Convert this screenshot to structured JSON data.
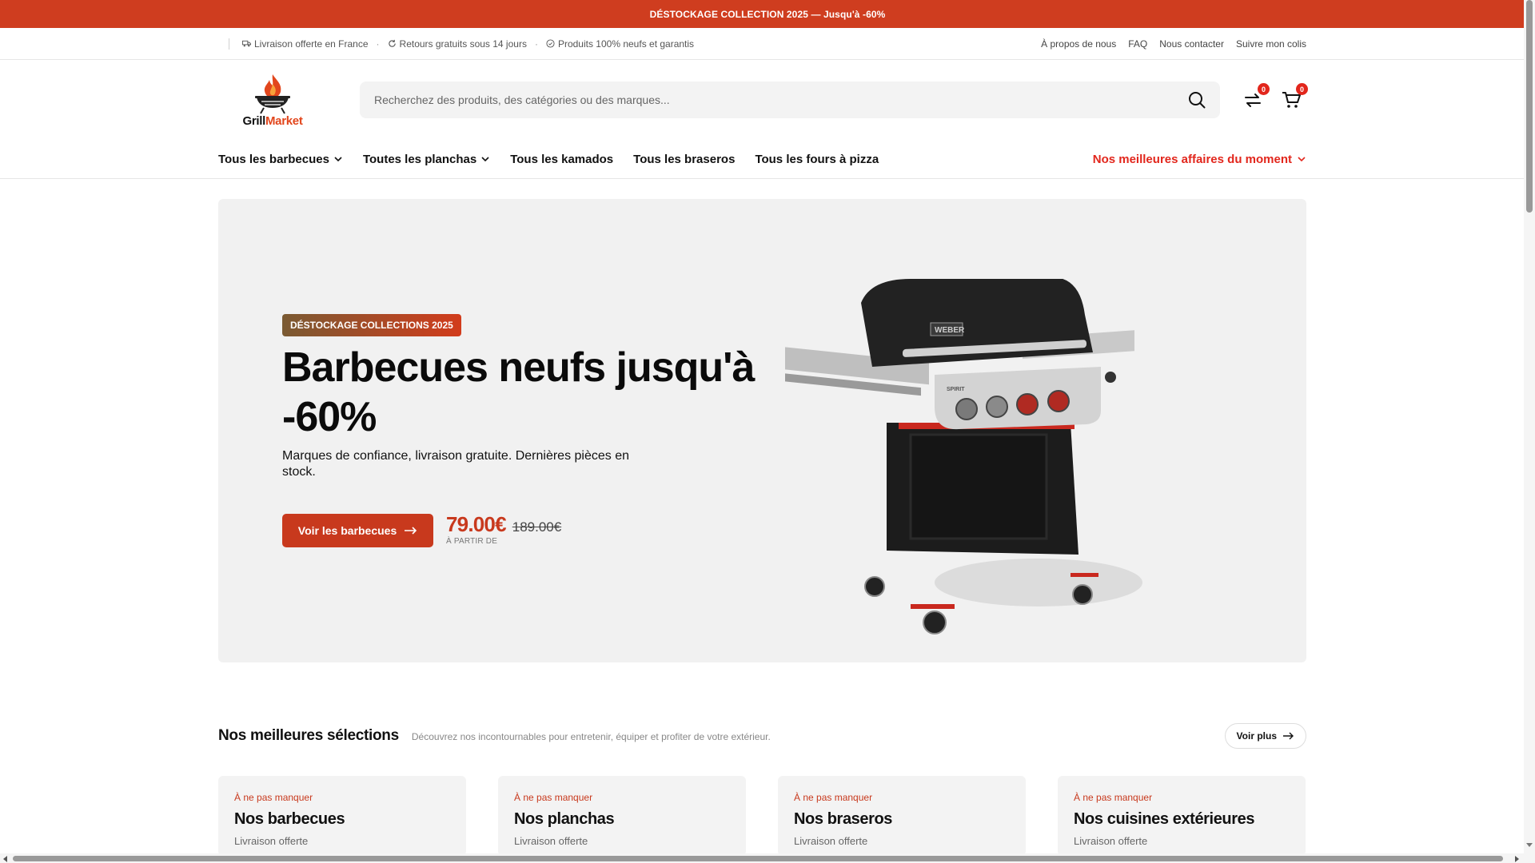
{
  "promo": {
    "text": "DÉSTOCKAGE COLLECTION 2025 — Jusqu'à -60%"
  },
  "utility": {
    "left": [
      {
        "icon": "truck-icon",
        "label": "Livraison offerte en France"
      },
      {
        "icon": "refresh-icon",
        "label": "Retours gratuits sous 14 jours"
      },
      {
        "icon": "check-circle-icon",
        "label": "Produits 100% neufs et garantis"
      }
    ],
    "right": [
      "À propos de nous",
      "FAQ",
      "Nous contacter",
      "Suivre mon colis"
    ]
  },
  "header": {
    "logo_grill": "Grill",
    "logo_market": "Market",
    "search_placeholder": "Recherchez des produits, des catégories ou des marques...",
    "compare_count": "0",
    "cart_count": "0"
  },
  "nav": {
    "items": [
      "Tous les barbecues",
      "Toutes les planchas",
      "Tous les kamados",
      "Tous les braseros",
      "Tous les fours à pizza"
    ],
    "deals": "Nos meilleures affaires du moment"
  },
  "hero": {
    "badge": "DÉSTOCKAGE COLLECTIONS 2025",
    "title": "Barbecues neufs jusqu'à -60%",
    "subtitle": "Marques de confiance, livraison gratuite. Dernières pièces en stock.",
    "cta": "Voir les barbecues",
    "price_new": "79.00€",
    "price_old": "189.00€",
    "price_label": "À PARTIR DE",
    "grill_brand": "WEBER",
    "grill_model": "SPIRIT"
  },
  "selections": {
    "title": "Nos meilleures sélections",
    "subtitle": "Découvrez nos incontournables pour entretenir, équiper et profiter de votre extérieur.",
    "more": "Voir plus",
    "cards": [
      {
        "eyebrow": "À ne pas manquer",
        "title": "Nos barbecues",
        "sub": "Livraison offerte"
      },
      {
        "eyebrow": "À ne pas manquer",
        "title": "Nos planchas",
        "sub": "Livraison offerte"
      },
      {
        "eyebrow": "À ne pas manquer",
        "title": "Nos braseros",
        "sub": "Livraison offerte"
      },
      {
        "eyebrow": "À ne pas manquer",
        "title": "Nos cuisines extérieures",
        "sub": "Livraison offerte"
      }
    ]
  },
  "colors": {
    "accent": "#c8391d",
    "promo_bg": "#cf3d1f",
    "deals": "#e2261c",
    "hero_bg": "#f1f1f1"
  }
}
